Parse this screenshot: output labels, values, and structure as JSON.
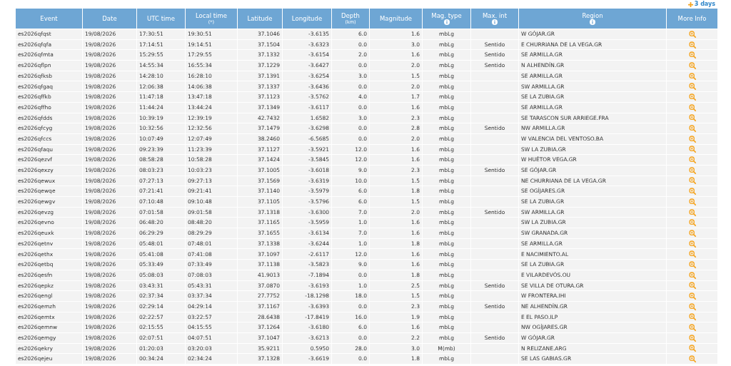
{
  "top_link": {
    "label": "3 days"
  },
  "table": {
    "columns": [
      {
        "label": "Event"
      },
      {
        "label": "Date"
      },
      {
        "label": "UTC time"
      },
      {
        "label": "Local time",
        "note": "(*)"
      },
      {
        "label": "Latitude"
      },
      {
        "label": "Longitude"
      },
      {
        "label": "Depth",
        "note": "(km)"
      },
      {
        "label": "Magnitude"
      },
      {
        "label": "Mag. type",
        "info": true
      },
      {
        "label": "Max. int",
        "info": true
      },
      {
        "label": "Region",
        "info": true
      },
      {
        "label": "More Info"
      }
    ],
    "rows": [
      [
        "es2026qfqst",
        "19/08/2026",
        "17:30:51",
        "19:30:51",
        "37.1046",
        "-3.6135",
        "6.0",
        "1.6",
        "mbLg",
        "",
        "W GÓJAR.GR"
      ],
      [
        "es2026qfqfa",
        "19/08/2026",
        "17:14:51",
        "19:14:51",
        "37.1504",
        "-3.6323",
        "0.0",
        "3.0",
        "mbLg",
        "Sentido",
        "E CHURRIANA DE LA VEGA.GR"
      ],
      [
        "es2026qfmta",
        "19/08/2026",
        "15:29:55",
        "17:29:55",
        "37.1332",
        "-3.6154",
        "2.0",
        "1.6",
        "mbLg",
        "Sentido",
        "SE ARMILLA.GR"
      ],
      [
        "es2026qflpn",
        "19/08/2026",
        "14:55:34",
        "16:55:34",
        "37.1229",
        "-3.6427",
        "0.0",
        "2.0",
        "mbLg",
        "Sentido",
        "N ALHENDÍN.GR"
      ],
      [
        "es2026qfksb",
        "19/08/2026",
        "14:28:10",
        "16:28:10",
        "37.1391",
        "-3.6254",
        "3.0",
        "1.5",
        "mbLg",
        "",
        "SE ARMILLA.GR"
      ],
      [
        "es2026qfgaq",
        "19/08/2026",
        "12:06:38",
        "14:06:38",
        "37.1337",
        "-3.6436",
        "0.0",
        "2.0",
        "mbLg",
        "",
        "SW ARMILLA.GR"
      ],
      [
        "es2026qffkb",
        "19/08/2026",
        "11:47:18",
        "13:47:18",
        "37.1123",
        "-3.5762",
        "4.0",
        "1.7",
        "mbLg",
        "",
        "SE LA ZUBIA.GR"
      ],
      [
        "es2026qffho",
        "19/08/2026",
        "11:44:24",
        "13:44:24",
        "37.1349",
        "-3.6117",
        "0.0",
        "1.6",
        "mbLg",
        "",
        "SE ARMILLA.GR"
      ],
      [
        "es2026qfdds",
        "19/08/2026",
        "10:39:19",
        "12:39:19",
        "42.7432",
        "1.6582",
        "3.0",
        "2.3",
        "mbLg",
        "",
        "SE TARASCON SUR ARRIEGE.FRA"
      ],
      [
        "es2026qfcyg",
        "19/08/2026",
        "10:32:56",
        "12:32:56",
        "37.1479",
        "-3.6298",
        "0.0",
        "2.8",
        "mbLg",
        "Sentido",
        "NW ARMILLA.GR"
      ],
      [
        "es2026qfccs",
        "19/08/2026",
        "10:07:49",
        "12:07:49",
        "38.2460",
        "-6.5685",
        "0.0",
        "2.0",
        "mbLg",
        "",
        "W VALENCIA DEL VENTOSO.BA"
      ],
      [
        "es2026qfaqu",
        "19/08/2026",
        "09:23:39",
        "11:23:39",
        "37.1127",
        "-3.5921",
        "12.0",
        "1.6",
        "mbLg",
        "",
        "SW LA ZUBIA.GR"
      ],
      [
        "es2026qezvf",
        "19/08/2026",
        "08:58:28",
        "10:58:28",
        "37.1424",
        "-3.5845",
        "12.0",
        "1.6",
        "mbLg",
        "",
        "W HUÉTOR VEGA.GR"
      ],
      [
        "es2026qexzy",
        "19/08/2026",
        "08:03:23",
        "10:03:23",
        "37.1005",
        "-3.6018",
        "9.0",
        "2.3",
        "mbLg",
        "Sentido",
        "SE GÓJAR.GR"
      ],
      [
        "es2026qewux",
        "19/08/2026",
        "07:27:13",
        "09:27:13",
        "37.1569",
        "-3.6319",
        "10.0",
        "1.5",
        "mbLg",
        "",
        "NE CHURRIANA DE LA VEGA.GR"
      ],
      [
        "es2026qewqe",
        "19/08/2026",
        "07:21:41",
        "09:21:41",
        "37.1140",
        "-3.5979",
        "6.0",
        "1.8",
        "mbLg",
        "",
        "SE OGÍJARES.GR"
      ],
      [
        "es2026qewgv",
        "19/08/2026",
        "07:10:48",
        "09:10:48",
        "37.1105",
        "-3.5796",
        "6.0",
        "1.5",
        "mbLg",
        "",
        "SE LA ZUBIA.GR"
      ],
      [
        "es2026qevzg",
        "19/08/2026",
        "07:01:58",
        "09:01:58",
        "37.1318",
        "-3.6300",
        "7.0",
        "2.0",
        "mbLg",
        "Sentido",
        "SW ARMILLA.GR"
      ],
      [
        "es2026qevno",
        "19/08/2026",
        "06:48:20",
        "08:48:20",
        "37.1165",
        "-3.5959",
        "1.0",
        "1.6",
        "mbLg",
        "",
        "SW LA ZUBIA.GR"
      ],
      [
        "es2026qeuxk",
        "19/08/2026",
        "06:29:29",
        "08:29:29",
        "37.1655",
        "-3.6134",
        "7.0",
        "1.6",
        "mbLg",
        "",
        "SW GRANADA.GR"
      ],
      [
        "es2026qetnv",
        "19/08/2026",
        "05:48:01",
        "07:48:01",
        "37.1338",
        "-3.6244",
        "1.0",
        "1.8",
        "mbLg",
        "",
        "SE ARMILLA.GR"
      ],
      [
        "es2026qethx",
        "19/08/2026",
        "05:41:08",
        "07:41:08",
        "37.1097",
        "-2.6117",
        "12.0",
        "1.6",
        "mbLg",
        "",
        "E NACIMIENTO.AL"
      ],
      [
        "es2026qetbq",
        "19/08/2026",
        "05:33:49",
        "07:33:49",
        "37.1138",
        "-3.5823",
        "9.0",
        "1.6",
        "mbLg",
        "",
        "SE LA ZUBIA.GR"
      ],
      [
        "es2026qesfn",
        "19/08/2026",
        "05:08:03",
        "07:08:03",
        "41.9013",
        "-7.1894",
        "0.0",
        "1.8",
        "mbLg",
        "",
        "E VILARDEVÓS.OU"
      ],
      [
        "es2026qepkz",
        "19/08/2026",
        "03:43:31",
        "05:43:31",
        "37.0870",
        "-3.6193",
        "1.0",
        "2.5",
        "mbLg",
        "Sentido",
        "SE VILLA DE OTURA.GR"
      ],
      [
        "es2026qengl",
        "19/08/2026",
        "02:37:34",
        "03:37:34",
        "27.7752",
        "-18.1298",
        "18.0",
        "1.5",
        "mbLg",
        "",
        "W FRONTERA.IHI"
      ],
      [
        "es2026qemzh",
        "19/08/2026",
        "02:29:14",
        "04:29:14",
        "37.1167",
        "-3.6393",
        "0.0",
        "2.3",
        "mbLg",
        "Sentido",
        "NE ALHENDÍN.GR"
      ],
      [
        "es2026qemtx",
        "19/08/2026",
        "02:22:57",
        "03:22:57",
        "28.6438",
        "-17.8419",
        "16.0",
        "1.9",
        "mbLg",
        "",
        "E EL PASO.ILP"
      ],
      [
        "es2026qemnw",
        "19/08/2026",
        "02:15:55",
        "04:15:55",
        "37.1264",
        "-3.6180",
        "6.0",
        "1.6",
        "mbLg",
        "",
        "NW OGÍJARES.GR"
      ],
      [
        "es2026qemgy",
        "19/08/2026",
        "02:07:51",
        "04:07:51",
        "37.1047",
        "-3.6213",
        "0.0",
        "2.2",
        "mbLg",
        "Sentido",
        "W GÓJAR.GR"
      ],
      [
        "es2026qekry",
        "19/08/2026",
        "01:20:03",
        "03:20:03",
        "35.9211",
        "0.5950",
        "28.0",
        "3.0",
        "M(mb)",
        "",
        "N RELIZANE.ARG"
      ],
      [
        "es2026qejeu",
        "19/08/2026",
        "00:34:24",
        "02:34:24",
        "37.1328",
        "-3.6619",
        "0.0",
        "1.8",
        "mbLg",
        "",
        "SE LAS GABIAS.GR"
      ]
    ]
  }
}
